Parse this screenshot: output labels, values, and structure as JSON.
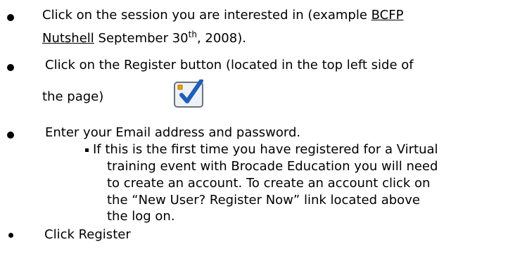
{
  "items": [
    {
      "line1_before": "Click on the session you are interested in (example ",
      "link_part1": "BCFP",
      "link_part2": "Nutshell",
      "line2_after": " September 30",
      "superscript": "th",
      "line2_end": ", 2008)."
    },
    {
      "line1": "Click on the Register button (located in the top left side of",
      "line2": "the page)",
      "icon": "register-checkbox-icon"
    },
    {
      "line1": "Enter your Email address and password.",
      "sub": {
        "line1": "If this is the first time you have registered for a Virtual",
        "line2": "training event with Brocade Education you will need",
        "line3": "to create an account. To create an account click on",
        "line4": "the “New User? Register Now” link located above",
        "line5": "the log on."
      }
    },
    {
      "line1": "Click Register"
    }
  ],
  "colors": {
    "text": "#000000",
    "icon_blue": "#1f5fb8",
    "icon_orange": "#e8a000",
    "icon_frame": "#6b7280"
  }
}
